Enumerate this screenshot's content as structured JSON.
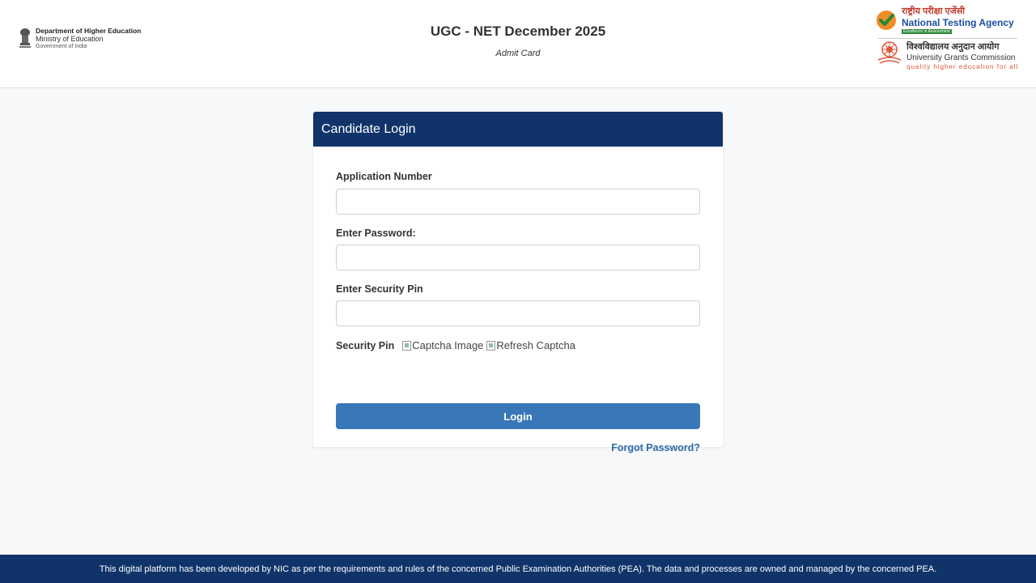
{
  "header": {
    "moe": {
      "line1": "Department of Higher Education",
      "line2": "Ministry of Education",
      "line3": "Government of India"
    },
    "title": "UGC - NET December 2025",
    "subtitle": "Admit Card",
    "nta": {
      "hindi": "राष्ट्रीय परीक्षा एजेंसी",
      "english": "National Testing Agency",
      "tagline": "Excellence in Assessment"
    },
    "ugc": {
      "hindi": "विश्वविद्यालय अनुदान आयोग",
      "english": "University Grants Commission",
      "tagline": "quality higher education for all"
    }
  },
  "login": {
    "title": "Candidate Login",
    "application_label": "Application Number",
    "application_value": "",
    "password_label": "Enter Password:",
    "password_value": "",
    "security_pin_label": "Enter Security Pin",
    "security_pin_value": "",
    "captcha_label": "Security Pin",
    "captcha_alt": "Captcha Image",
    "refresh_alt": "Refresh Captcha",
    "button_label": "Login",
    "forgot_label": "Forgot Password?"
  },
  "footer": {
    "text": "This digital platform has been developed by NIC as per the requirements and rules of the concerned Public Examination Authorities (PEA). The data and processes are owned and managed by the concerned PEA."
  },
  "colors": {
    "navy": "#10346a",
    "button": "#3877b8",
    "link": "#2c6aa6",
    "background": "#f6f8fa"
  },
  "icons": {
    "emblem": "national-emblem-icon",
    "nta": "nta-checkmark-icon",
    "ugc": "ugc-emblem-icon",
    "broken_image": "broken-image-icon"
  }
}
